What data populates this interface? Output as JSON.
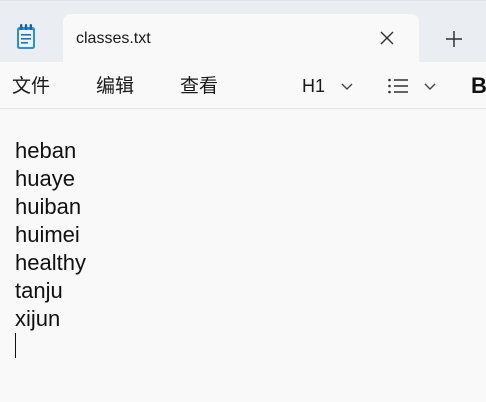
{
  "tab": {
    "title": "classes.txt",
    "icon": "notepad-icon",
    "close_icon": "close-icon",
    "new_tab_icon": "plus-icon"
  },
  "menu": {
    "file": "文件",
    "edit": "编辑",
    "view": "查看"
  },
  "format": {
    "heading": "H1",
    "list_icon": "list-icon",
    "bold": "B"
  },
  "editor": {
    "lines": [
      "heban",
      "huaye",
      "huiban",
      "huimei",
      "healthy",
      "tanju",
      "xijun"
    ]
  },
  "colors": {
    "accent": "#2f8fd6",
    "titlebar": "#eaeef2",
    "background": "#f9f9f9"
  }
}
